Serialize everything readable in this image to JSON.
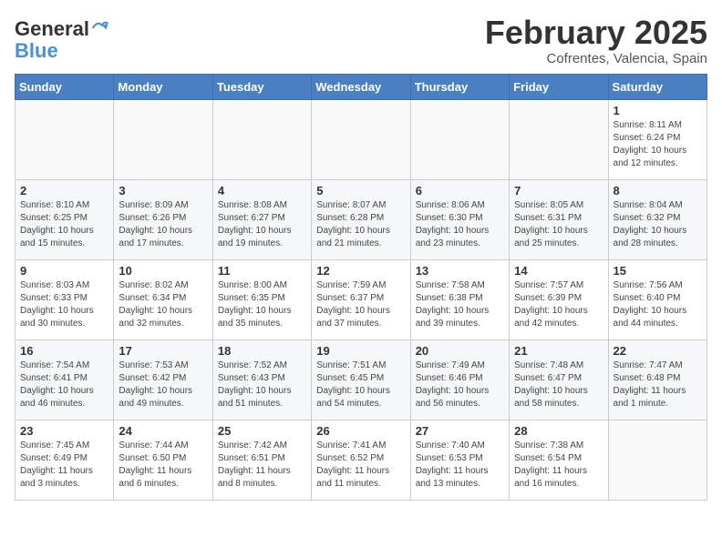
{
  "logo": {
    "line1": "General",
    "line2": "Blue"
  },
  "header": {
    "title": "February 2025",
    "subtitle": "Cofrentes, Valencia, Spain"
  },
  "weekdays": [
    "Sunday",
    "Monday",
    "Tuesday",
    "Wednesday",
    "Thursday",
    "Friday",
    "Saturday"
  ],
  "weeks": [
    [
      {
        "day": "",
        "info": ""
      },
      {
        "day": "",
        "info": ""
      },
      {
        "day": "",
        "info": ""
      },
      {
        "day": "",
        "info": ""
      },
      {
        "day": "",
        "info": ""
      },
      {
        "day": "",
        "info": ""
      },
      {
        "day": "1",
        "info": "Sunrise: 8:11 AM\nSunset: 6:24 PM\nDaylight: 10 hours\nand 12 minutes."
      }
    ],
    [
      {
        "day": "2",
        "info": "Sunrise: 8:10 AM\nSunset: 6:25 PM\nDaylight: 10 hours\nand 15 minutes."
      },
      {
        "day": "3",
        "info": "Sunrise: 8:09 AM\nSunset: 6:26 PM\nDaylight: 10 hours\nand 17 minutes."
      },
      {
        "day": "4",
        "info": "Sunrise: 8:08 AM\nSunset: 6:27 PM\nDaylight: 10 hours\nand 19 minutes."
      },
      {
        "day": "5",
        "info": "Sunrise: 8:07 AM\nSunset: 6:28 PM\nDaylight: 10 hours\nand 21 minutes."
      },
      {
        "day": "6",
        "info": "Sunrise: 8:06 AM\nSunset: 6:30 PM\nDaylight: 10 hours\nand 23 minutes."
      },
      {
        "day": "7",
        "info": "Sunrise: 8:05 AM\nSunset: 6:31 PM\nDaylight: 10 hours\nand 25 minutes."
      },
      {
        "day": "8",
        "info": "Sunrise: 8:04 AM\nSunset: 6:32 PM\nDaylight: 10 hours\nand 28 minutes."
      }
    ],
    [
      {
        "day": "9",
        "info": "Sunrise: 8:03 AM\nSunset: 6:33 PM\nDaylight: 10 hours\nand 30 minutes."
      },
      {
        "day": "10",
        "info": "Sunrise: 8:02 AM\nSunset: 6:34 PM\nDaylight: 10 hours\nand 32 minutes."
      },
      {
        "day": "11",
        "info": "Sunrise: 8:00 AM\nSunset: 6:35 PM\nDaylight: 10 hours\nand 35 minutes."
      },
      {
        "day": "12",
        "info": "Sunrise: 7:59 AM\nSunset: 6:37 PM\nDaylight: 10 hours\nand 37 minutes."
      },
      {
        "day": "13",
        "info": "Sunrise: 7:58 AM\nSunset: 6:38 PM\nDaylight: 10 hours\nand 39 minutes."
      },
      {
        "day": "14",
        "info": "Sunrise: 7:57 AM\nSunset: 6:39 PM\nDaylight: 10 hours\nand 42 minutes."
      },
      {
        "day": "15",
        "info": "Sunrise: 7:56 AM\nSunset: 6:40 PM\nDaylight: 10 hours\nand 44 minutes."
      }
    ],
    [
      {
        "day": "16",
        "info": "Sunrise: 7:54 AM\nSunset: 6:41 PM\nDaylight: 10 hours\nand 46 minutes."
      },
      {
        "day": "17",
        "info": "Sunrise: 7:53 AM\nSunset: 6:42 PM\nDaylight: 10 hours\nand 49 minutes."
      },
      {
        "day": "18",
        "info": "Sunrise: 7:52 AM\nSunset: 6:43 PM\nDaylight: 10 hours\nand 51 minutes."
      },
      {
        "day": "19",
        "info": "Sunrise: 7:51 AM\nSunset: 6:45 PM\nDaylight: 10 hours\nand 54 minutes."
      },
      {
        "day": "20",
        "info": "Sunrise: 7:49 AM\nSunset: 6:46 PM\nDaylight: 10 hours\nand 56 minutes."
      },
      {
        "day": "21",
        "info": "Sunrise: 7:48 AM\nSunset: 6:47 PM\nDaylight: 10 hours\nand 58 minutes."
      },
      {
        "day": "22",
        "info": "Sunrise: 7:47 AM\nSunset: 6:48 PM\nDaylight: 11 hours\nand 1 minute."
      }
    ],
    [
      {
        "day": "23",
        "info": "Sunrise: 7:45 AM\nSunset: 6:49 PM\nDaylight: 11 hours\nand 3 minutes."
      },
      {
        "day": "24",
        "info": "Sunrise: 7:44 AM\nSunset: 6:50 PM\nDaylight: 11 hours\nand 6 minutes."
      },
      {
        "day": "25",
        "info": "Sunrise: 7:42 AM\nSunset: 6:51 PM\nDaylight: 11 hours\nand 8 minutes."
      },
      {
        "day": "26",
        "info": "Sunrise: 7:41 AM\nSunset: 6:52 PM\nDaylight: 11 hours\nand 11 minutes."
      },
      {
        "day": "27",
        "info": "Sunrise: 7:40 AM\nSunset: 6:53 PM\nDaylight: 11 hours\nand 13 minutes."
      },
      {
        "day": "28",
        "info": "Sunrise: 7:38 AM\nSunset: 6:54 PM\nDaylight: 11 hours\nand 16 minutes."
      },
      {
        "day": "",
        "info": ""
      }
    ]
  ]
}
